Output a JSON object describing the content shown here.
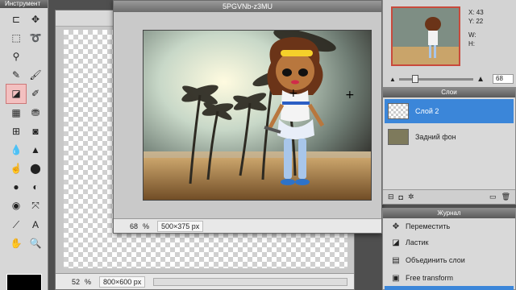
{
  "tools_panel": {
    "title": "Инструмент",
    "tools": [
      {
        "name": "crop-icon",
        "glyph": "⊏"
      },
      {
        "name": "move-icon",
        "glyph": "✥"
      },
      {
        "name": "marquee-icon",
        "glyph": "⬚"
      },
      {
        "name": "lasso-icon",
        "glyph": "➰"
      },
      {
        "name": "wand-icon",
        "glyph": "⚲"
      },
      {
        "name": "spacer",
        "glyph": ""
      },
      {
        "name": "pencil-icon",
        "glyph": "✎"
      },
      {
        "name": "brush-icon",
        "glyph": "🖌"
      },
      {
        "name": "eraser-icon",
        "glyph": "◪"
      },
      {
        "name": "replace-color-icon",
        "glyph": "✐"
      },
      {
        "name": "gradient-icon",
        "glyph": "▦"
      },
      {
        "name": "stamp-icon",
        "glyph": "⛃"
      },
      {
        "name": "heal-icon",
        "glyph": "⊞"
      },
      {
        "name": "color-replace-icon",
        "glyph": "◙"
      },
      {
        "name": "drop-icon",
        "glyph": "💧"
      },
      {
        "name": "sharpen-icon",
        "glyph": "▲"
      },
      {
        "name": "smudge-icon",
        "glyph": "☝"
      },
      {
        "name": "sponge-icon",
        "glyph": "⬤"
      },
      {
        "name": "burn-icon",
        "glyph": "●"
      },
      {
        "name": "dodge-icon",
        "glyph": "◐"
      },
      {
        "name": "red-eye-icon",
        "glyph": "◉"
      },
      {
        "name": "bloat-icon",
        "glyph": "⤧"
      },
      {
        "name": "eyedropper-icon",
        "glyph": "⟋"
      },
      {
        "name": "text-icon",
        "glyph": "A"
      },
      {
        "name": "hand-icon",
        "glyph": "✋"
      },
      {
        "name": "zoom-icon",
        "glyph": "🔍"
      }
    ]
  },
  "doc_back": {
    "zoom": "52",
    "pct": "%",
    "dims": "800×600 px"
  },
  "doc_front": {
    "title": "5PGVNb-z3MU",
    "zoom": "68",
    "pct": "%",
    "dims": "500×375 px"
  },
  "navigator": {
    "x_label": "X:",
    "x_value": "43",
    "y_label": "Y:",
    "y_value": "22",
    "w_label": "W:",
    "h_label": "H:",
    "zoom_value": "68"
  },
  "layers": {
    "title": "Слои",
    "items": [
      {
        "name": "Слой 2",
        "active": true
      },
      {
        "name": "Задний фон",
        "active": false
      }
    ]
  },
  "history": {
    "title": "Журнал",
    "items": [
      {
        "label": "Переместить",
        "icon": "move-icon",
        "glyph": "✥"
      },
      {
        "label": "Ластик",
        "icon": "eraser-icon",
        "glyph": "◪"
      },
      {
        "label": "Объединить слои",
        "icon": "merge-icon",
        "glyph": "▤"
      },
      {
        "label": "Free transform",
        "icon": "transform-icon",
        "glyph": "▣"
      },
      {
        "label": "",
        "icon": "",
        "glyph": ""
      }
    ]
  }
}
